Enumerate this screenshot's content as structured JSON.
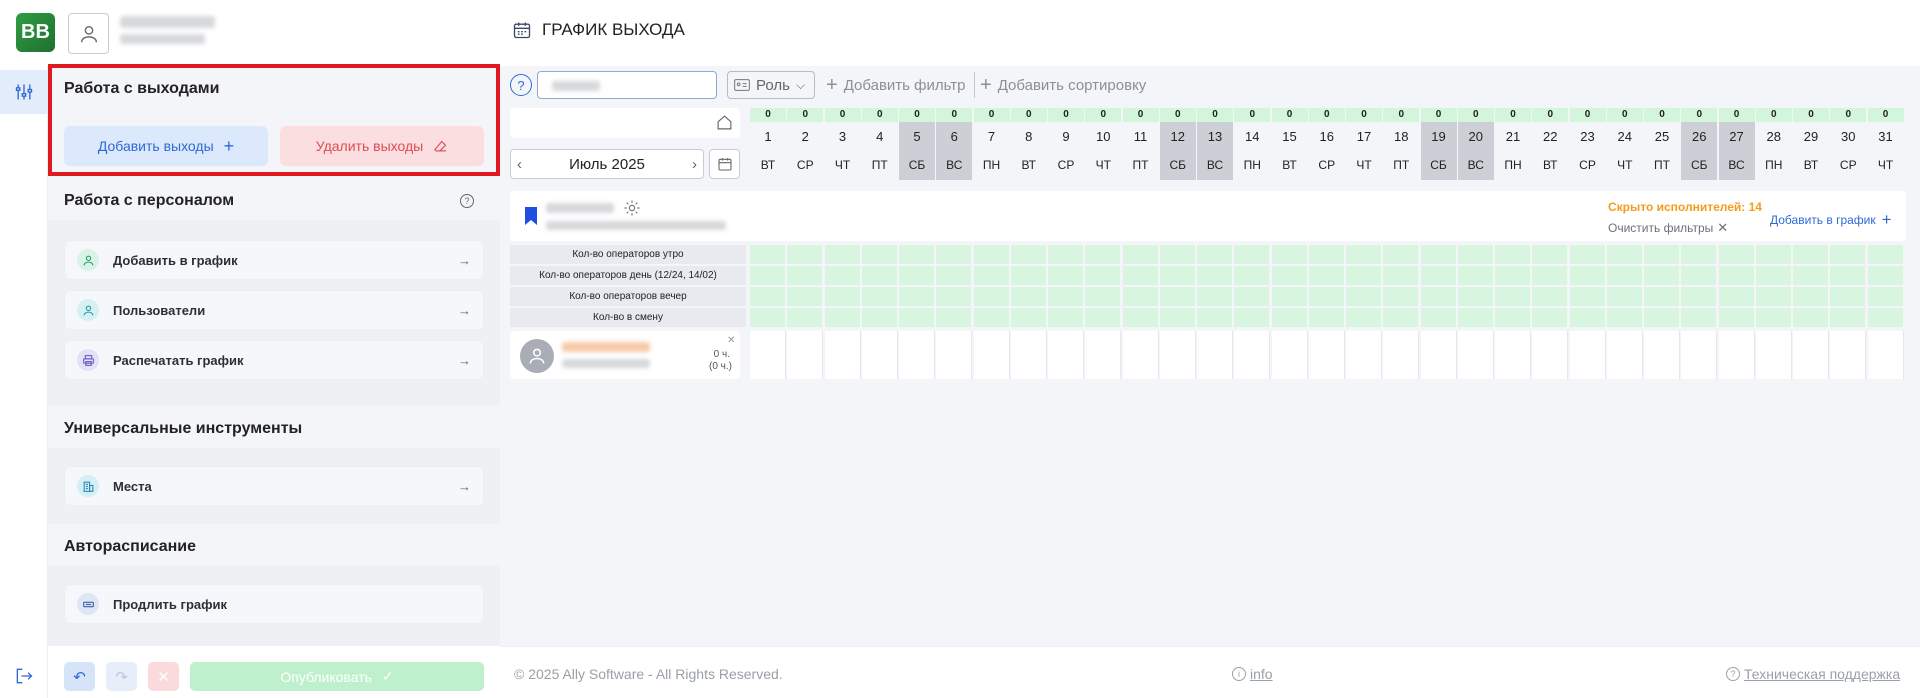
{
  "app": {
    "logo_text": "BB"
  },
  "header": {
    "title": "ГРАФИК ВЫХОДА",
    "icon": "calendar-icon"
  },
  "sidebar": {
    "exits": {
      "title": "Работа с выходами",
      "add_label": "Добавить выходы",
      "delete_label": "Удалить выходы"
    },
    "staff": {
      "title": "Работа с персоналом",
      "items": [
        {
          "label": "Добавить в график",
          "icon": "user-icon"
        },
        {
          "label": "Пользователи",
          "icon": "user-icon"
        },
        {
          "label": "Распечатать график",
          "icon": "printer-icon"
        }
      ]
    },
    "tools": {
      "title": "Универсальные инструменты",
      "items": [
        {
          "label": "Места",
          "icon": "building-icon"
        }
      ]
    },
    "autoschedule": {
      "title": "Авторасписание",
      "items": [
        {
          "label": "Продлить график",
          "icon": "extend-icon"
        }
      ]
    }
  },
  "bottombar": {
    "publish_label": "Опубликовать"
  },
  "toolbar": {
    "role_label": "Роль",
    "add_filter_label": "Добавить фильтр",
    "add_sort_label": "Добавить сортировку",
    "help": "?"
  },
  "calendar": {
    "month_label": "Июль 2025",
    "days": [
      {
        "n": "1",
        "wd": "ВТ",
        "c": "0",
        "we": false
      },
      {
        "n": "2",
        "wd": "СР",
        "c": "0",
        "we": false
      },
      {
        "n": "3",
        "wd": "ЧТ",
        "c": "0",
        "we": false
      },
      {
        "n": "4",
        "wd": "ПТ",
        "c": "0",
        "we": false
      },
      {
        "n": "5",
        "wd": "СБ",
        "c": "0",
        "we": true
      },
      {
        "n": "6",
        "wd": "ВС",
        "c": "0",
        "we": true
      },
      {
        "n": "7",
        "wd": "ПН",
        "c": "0",
        "we": false
      },
      {
        "n": "8",
        "wd": "ВТ",
        "c": "0",
        "we": false
      },
      {
        "n": "9",
        "wd": "СР",
        "c": "0",
        "we": false
      },
      {
        "n": "10",
        "wd": "ЧТ",
        "c": "0",
        "we": false
      },
      {
        "n": "11",
        "wd": "ПТ",
        "c": "0",
        "we": false
      },
      {
        "n": "12",
        "wd": "СБ",
        "c": "0",
        "we": true
      },
      {
        "n": "13",
        "wd": "ВС",
        "c": "0",
        "we": true
      },
      {
        "n": "14",
        "wd": "ПН",
        "c": "0",
        "we": false
      },
      {
        "n": "15",
        "wd": "ВТ",
        "c": "0",
        "we": false
      },
      {
        "n": "16",
        "wd": "СР",
        "c": "0",
        "we": false
      },
      {
        "n": "17",
        "wd": "ЧТ",
        "c": "0",
        "we": false
      },
      {
        "n": "18",
        "wd": "ПТ",
        "c": "0",
        "we": false
      },
      {
        "n": "19",
        "wd": "СБ",
        "c": "0",
        "we": true
      },
      {
        "n": "20",
        "wd": "ВС",
        "c": "0",
        "we": true
      },
      {
        "n": "21",
        "wd": "ПН",
        "c": "0",
        "we": false
      },
      {
        "n": "22",
        "wd": "ВТ",
        "c": "0",
        "we": false
      },
      {
        "n": "23",
        "wd": "СР",
        "c": "0",
        "we": false
      },
      {
        "n": "24",
        "wd": "ЧТ",
        "c": "0",
        "we": false
      },
      {
        "n": "25",
        "wd": "ПТ",
        "c": "0",
        "we": false
      },
      {
        "n": "26",
        "wd": "СБ",
        "c": "0",
        "we": true
      },
      {
        "n": "27",
        "wd": "ВС",
        "c": "0",
        "we": true
      },
      {
        "n": "28",
        "wd": "ПН",
        "c": "0",
        "we": false
      },
      {
        "n": "29",
        "wd": "ВТ",
        "c": "0",
        "we": false
      },
      {
        "n": "30",
        "wd": "СР",
        "c": "0",
        "we": false
      },
      {
        "n": "31",
        "wd": "ЧТ",
        "c": "0",
        "we": false
      }
    ]
  },
  "group": {
    "hidden_label": "Скрыто исполнителей: 14",
    "clear_filters_label": "Очистить фильтры",
    "add_to_schedule_label": "Добавить в график",
    "stats": [
      "Кол-во операторов утро",
      "Кол-во операторов день (12/24, 14/02)",
      "Кол-во операторов вечер",
      "Кол-во в смену"
    ]
  },
  "person": {
    "hours": "0 ч.",
    "hours_alt": "(0 ч.)"
  },
  "footer": {
    "copyright": "© 2025 Ally Software - All Rights Reserved.",
    "info": "info",
    "support": "Техническая поддержка"
  },
  "colors": {
    "accent": "#2e6ad6",
    "danger": "#e0181f",
    "hidden_orange": "#f49d1d"
  }
}
